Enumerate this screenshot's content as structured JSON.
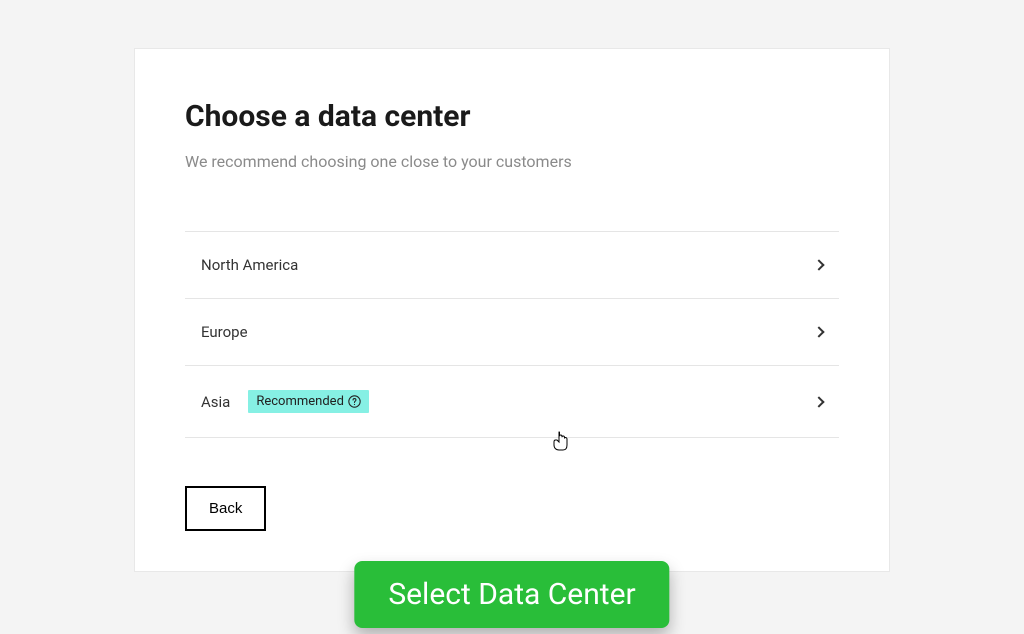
{
  "title": "Choose a data center",
  "subtitle": "We recommend choosing one close to your customers",
  "options": [
    {
      "label": "North America",
      "recommended": false
    },
    {
      "label": "Europe",
      "recommended": false
    },
    {
      "label": "Asia",
      "recommended": true
    }
  ],
  "badge_label": "Recommended",
  "back_label": "Back",
  "banner_label": "Select Data Center"
}
